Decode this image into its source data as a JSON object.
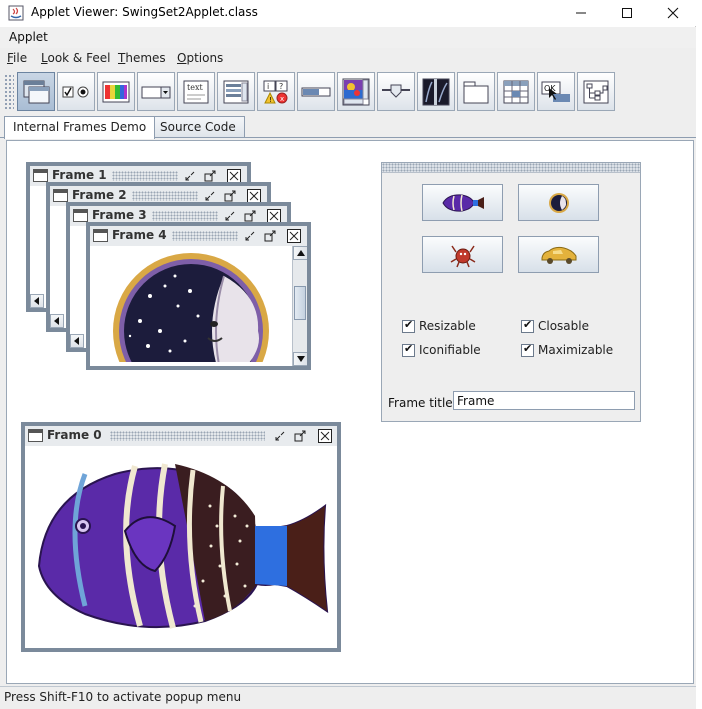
{
  "window": {
    "title": "Applet Viewer: SwingSet2Applet.class",
    "applet_menu": "Applet"
  },
  "menubar": {
    "items": [
      {
        "label": "File",
        "mnemonic": "F"
      },
      {
        "label": "Look & Feel",
        "mnemonic": "L"
      },
      {
        "label": "Themes",
        "mnemonic": "T"
      },
      {
        "label": "Options",
        "mnemonic": "O"
      }
    ]
  },
  "toolbar": {
    "buttons": [
      {
        "icon": "internal-frame-icon",
        "active": true
      },
      {
        "icon": "buttons-icon"
      },
      {
        "icon": "color-chooser-icon"
      },
      {
        "icon": "combobox-icon"
      },
      {
        "icon": "file-chooser-icon",
        "text": "text"
      },
      {
        "icon": "list-icon"
      },
      {
        "icon": "option-pane-icon"
      },
      {
        "icon": "progress-bar-icon"
      },
      {
        "icon": "scroll-pane-icon"
      },
      {
        "icon": "slider-icon"
      },
      {
        "icon": "split-pane-icon"
      },
      {
        "icon": "tabbed-pane-icon"
      },
      {
        "icon": "table-icon"
      },
      {
        "icon": "tooltip-icon",
        "text": "OK"
      },
      {
        "icon": "tree-icon"
      }
    ]
  },
  "tabs": [
    {
      "label": "Internal Frames Demo",
      "selected": true
    },
    {
      "label": "Source Code",
      "selected": false
    }
  ],
  "frames": {
    "f1": "Frame 1",
    "f2": "Frame 2",
    "f3": "Frame 3",
    "f4": "Frame 4",
    "f0": "Frame 0"
  },
  "panel": {
    "checkboxes": [
      {
        "label": "Resizable",
        "checked": true
      },
      {
        "label": "Closable",
        "checked": true
      },
      {
        "label": "Iconifiable",
        "checked": true
      },
      {
        "label": "Maximizable",
        "checked": true
      }
    ],
    "frame_title_label": "Frame title:",
    "frame_title_value": "Frame"
  },
  "status": "Press Shift-F10 to activate popup menu"
}
